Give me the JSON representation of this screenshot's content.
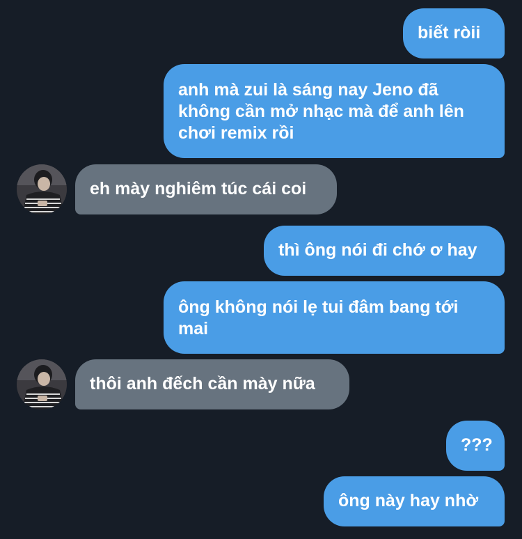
{
  "messages": [
    {
      "from": "me",
      "text": "biết ròii"
    },
    {
      "from": "me",
      "text": "anh mà zui là sáng nay Jeno đã không cần mở nhạc mà để anh lên chơi remix rồi"
    },
    {
      "from": "them",
      "text": "eh mày nghiêm túc cái coi"
    },
    {
      "from": "me",
      "text": "thì ông nói đi chớ ơ hay"
    },
    {
      "from": "me",
      "text": "ông không nói lẹ tui đâm bang tới mai"
    },
    {
      "from": "them",
      "text": "thôi anh đếch cần mày nữa"
    },
    {
      "from": "me",
      "text": "???"
    },
    {
      "from": "me",
      "text": "ông này hay nhờ"
    }
  ],
  "colors": {
    "background": "#161d27",
    "sent_bubble": "#4a9de6",
    "received_bubble": "#67737f",
    "text": "#ffffff"
  }
}
